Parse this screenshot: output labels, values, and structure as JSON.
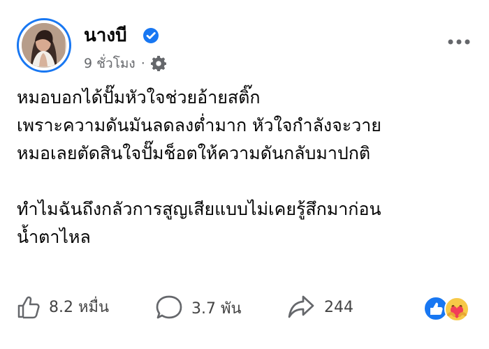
{
  "post": {
    "author_name": "นางบี",
    "timestamp": "9 ชั่วโมง",
    "separator": "·",
    "text_lines": [
      "หมอบอกได้ปั๊มหัวใจช่วยอ้ายสติ๊ก",
      "เพราะความดันมันลดลงต่ำมาก หัวใจกำลังจะวาย",
      "หมอเลยตัดสินใจปั๊มช็อตให้ความดันกลับมาปกติ",
      "",
      "ทำไมฉันถึงกลัวการสูญเสียแบบไม่เคยรู้สึกมาก่อน",
      "น้ำตาไหล"
    ]
  },
  "actions": {
    "like_count": "8.2 หมื่น",
    "comment_count": "3.7 พัน",
    "share_count": "244"
  },
  "icons": {
    "verified": "verified-badge-icon",
    "audience": "gear-icon",
    "more": "more-options-icon",
    "like": "thumbs-up-icon",
    "comment": "comment-icon",
    "share": "share-arrow-icon",
    "reactions": [
      "like-reaction-icon",
      "care-reaction-icon"
    ]
  },
  "colors": {
    "facebook_blue": "#1877f2",
    "text_primary": "#050505",
    "text_secondary": "#65676b",
    "care_yellow": "#f7c948",
    "heart_red": "#f33e58"
  }
}
